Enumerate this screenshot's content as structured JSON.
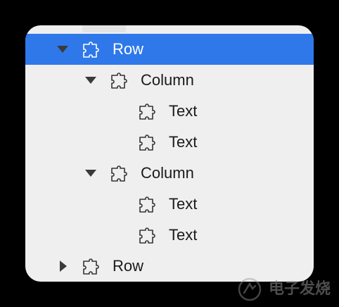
{
  "tree": {
    "rows": [
      {
        "label": "Row",
        "arrow": "expanded",
        "icon": "puzzle-piece-icon",
        "selected": true
      },
      {
        "label": "Column",
        "arrow": "expanded",
        "icon": "puzzle-piece-icon",
        "selected": false
      },
      {
        "label": "Text",
        "arrow": "none",
        "icon": "puzzle-piece-icon",
        "selected": false
      },
      {
        "label": "Text",
        "arrow": "none",
        "icon": "puzzle-piece-icon",
        "selected": false
      },
      {
        "label": "Column",
        "arrow": "expanded",
        "icon": "puzzle-piece-icon",
        "selected": false
      },
      {
        "label": "Text",
        "arrow": "none",
        "icon": "puzzle-piece-icon",
        "selected": false
      },
      {
        "label": "Text",
        "arrow": "none",
        "icon": "puzzle-piece-icon",
        "selected": false
      },
      {
        "label": "Row",
        "arrow": "collapsed",
        "icon": "puzzle-piece-icon",
        "selected": false
      }
    ]
  },
  "watermark": {
    "text": "电子发烧",
    "icon": "watermark-logo"
  },
  "colors": {
    "selection": "#2f78ea",
    "panel_bg": "#efefef",
    "text": "#1a1a1a"
  }
}
